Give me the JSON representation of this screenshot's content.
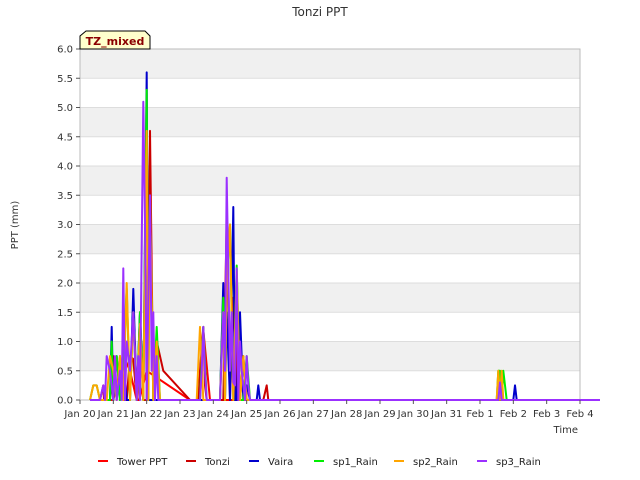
{
  "chart_data": {
    "type": "line",
    "title": "Tonzi PPT",
    "badge": "TZ_mixed",
    "xlabel": "Time",
    "ylabel": "PPT (mm)",
    "ylim": [
      0,
      6
    ],
    "yticks": [
      0.0,
      0.5,
      1.0,
      1.5,
      2.0,
      2.5,
      3.0,
      3.5,
      4.0,
      4.5,
      5.0,
      5.5,
      6.0
    ],
    "ytick_labels": [
      "0.0",
      "0.5",
      "1.0",
      "1.5",
      "2.0",
      "2.5",
      "3.0",
      "3.5",
      "4.0",
      "4.5",
      "5.0",
      "5.5",
      "6.0"
    ],
    "xlim": [
      0,
      15
    ],
    "xticks": [
      0,
      1,
      2,
      3,
      4,
      5,
      6,
      7,
      8,
      9,
      10,
      11,
      12,
      13,
      14,
      15
    ],
    "xtick_labels": [
      "Jan 20",
      "Jan 21",
      "Jan 22",
      "Jan 23",
      "Jan 24",
      "Jan 25",
      "Jan 26",
      "Jan 27",
      "Jan 28",
      "Jan 29",
      "Jan 30",
      "Jan 31",
      "Feb 1",
      "Feb 2",
      "Feb 3",
      "Feb 4"
    ],
    "grid": "horizontal bands",
    "legend_position": "bottom",
    "colors": {
      "band": "#f0f0f0",
      "grid": "#dddddd",
      "axis": "#bbbbbb",
      "badge_bg": "#ffffcc"
    },
    "series": [
      {
        "name": "Tower PPT",
        "color": "#ff0000",
        "x": [
          0.3,
          1.0,
          1.2,
          1.35,
          1.5,
          1.7,
          1.78,
          2.0,
          3.3,
          3.6,
          3.7,
          3.9,
          4.0,
          4.2,
          4.3,
          4.5,
          4.6,
          4.7,
          4.85,
          5.0,
          5.1,
          5.2,
          5.3,
          5.5,
          7.5,
          10.0,
          12.5,
          13.5,
          15.6
        ],
        "y": [
          0,
          0,
          0.5,
          0.7,
          0.5,
          0,
          0,
          0.5,
          0,
          0,
          1.2,
          0,
          0,
          0,
          0,
          0,
          0,
          0,
          0,
          0,
          0,
          0,
          0,
          0,
          0,
          0,
          0,
          0,
          0
        ]
      },
      {
        "name": "Tonzi",
        "color": "#cc0000",
        "x": [
          0.3,
          0.6,
          0.7,
          0.72,
          0.9,
          1.0,
          1.1,
          1.2,
          1.3,
          1.32,
          1.4,
          1.5,
          1.6,
          1.7,
          1.72,
          1.8,
          1.9,
          2.0,
          2.1,
          2.2,
          2.3,
          2.5,
          3.3,
          3.5,
          3.55,
          3.6,
          3.7,
          3.75,
          3.8,
          3.9,
          4.0,
          4.2,
          4.22,
          4.3,
          4.4,
          4.45,
          4.5,
          4.6,
          4.7,
          4.72,
          4.8,
          4.9,
          5.0,
          5.1,
          5.2,
          5.4,
          5.5,
          5.6,
          5.65,
          5.7,
          6.0,
          12.0,
          12.6,
          12.65,
          12.7,
          12.8,
          15.6
        ],
        "y": [
          0,
          0,
          0.25,
          0,
          0,
          0.75,
          0,
          0.75,
          0,
          0,
          0,
          0.75,
          0.7,
          0,
          0,
          1.5,
          0,
          0,
          4.6,
          0,
          1.0,
          0.5,
          0,
          0,
          0,
          0.5,
          1.25,
          0.25,
          0,
          0,
          0,
          0,
          0,
          0,
          3.1,
          2.0,
          0,
          1.75,
          0,
          1.0,
          0,
          0.75,
          0,
          0,
          0,
          0,
          0,
          0.25,
          0,
          0,
          0,
          0,
          0,
          0.25,
          0,
          0,
          0
        ]
      },
      {
        "name": "Vaira",
        "color": "#0000cc",
        "x": [
          0.3,
          0.7,
          0.9,
          0.95,
          1.0,
          1.1,
          1.2,
          1.3,
          1.4,
          1.5,
          1.6,
          1.7,
          1.8,
          1.9,
          2.0,
          2.05,
          2.1,
          2.15,
          2.2,
          2.3,
          2.5,
          3.3,
          3.7,
          3.8,
          4.0,
          4.2,
          4.3,
          4.35,
          4.4,
          4.5,
          4.6,
          4.65,
          4.7,
          4.8,
          4.9,
          5.0,
          5.1,
          5.3,
          5.35,
          5.4,
          6.0,
          12.0,
          12.6,
          12.7,
          12.8,
          13.0,
          13.05,
          13.1,
          15.6
        ],
        "y": [
          0,
          0,
          0,
          1.25,
          0,
          0.75,
          0,
          0.75,
          0,
          0,
          1.9,
          0,
          1.5,
          0,
          5.6,
          0,
          0,
          0,
          0,
          0,
          0,
          0,
          0,
          0,
          0,
          0,
          2.0,
          0,
          1.5,
          0,
          3.3,
          0,
          0,
          1.5,
          0,
          0.25,
          0,
          0,
          0.25,
          0,
          0,
          0,
          0,
          0,
          0,
          0,
          0.25,
          0,
          0
        ]
      },
      {
        "name": "sp1_Rain",
        "color": "#00ee00",
        "x": [
          0.3,
          0.4,
          0.5,
          0.6,
          0.9,
          0.95,
          1.0,
          1.1,
          1.2,
          1.3,
          1.4,
          1.5,
          1.6,
          1.7,
          1.8,
          1.9,
          2.0,
          2.05,
          2.1,
          2.2,
          2.3,
          2.4,
          2.5,
          3.3,
          3.6,
          3.7,
          3.8,
          4.0,
          4.2,
          4.3,
          4.35,
          4.4,
          4.5,
          4.6,
          4.7,
          4.8,
          4.9,
          5.0,
          5.1,
          5.3,
          6.0,
          12.0,
          12.5,
          12.55,
          12.6,
          12.65,
          12.7,
          12.8,
          15.6
        ],
        "y": [
          0,
          0.25,
          0.25,
          0,
          0,
          1.0,
          0,
          0.75,
          0,
          0.75,
          1.9,
          0,
          1.5,
          0,
          1.5,
          0,
          5.3,
          0,
          3.4,
          0,
          1.25,
          0,
          0,
          0,
          0,
          1.25,
          0,
          0,
          0,
          1.75,
          0,
          2.0,
          3.0,
          0,
          2.3,
          0,
          0,
          0.75,
          0,
          0,
          0,
          0,
          0,
          0.5,
          0.5,
          0,
          0.5,
          0,
          0
        ]
      },
      {
        "name": "sp2_Rain",
        "color": "#ffa500",
        "x": [
          0.3,
          0.4,
          0.5,
          0.6,
          0.8,
          0.9,
          1.0,
          1.1,
          1.2,
          1.3,
          1.4,
          1.5,
          1.6,
          1.7,
          1.8,
          1.9,
          2.0,
          2.05,
          2.1,
          2.2,
          2.3,
          2.4,
          3.3,
          3.5,
          3.6,
          3.7,
          3.8,
          4.0,
          4.2,
          4.3,
          4.35,
          4.4,
          4.5,
          4.6,
          4.7,
          4.8,
          4.9,
          5.0,
          5.1,
          5.3,
          6.0,
          12.0,
          12.5,
          12.55,
          12.6,
          12.65,
          12.7,
          12.8,
          15.6
        ],
        "y": [
          0,
          0.25,
          0.25,
          0,
          0,
          0.75,
          0.5,
          0,
          0.75,
          0,
          2.0,
          0,
          1.5,
          0,
          1.3,
          0,
          4.6,
          0,
          3.4,
          0,
          1.0,
          0,
          0,
          0,
          1.25,
          0,
          0,
          0,
          0,
          1.5,
          0,
          2.0,
          3.0,
          0,
          2.2,
          0,
          0.75,
          0,
          0,
          0,
          0,
          0,
          0,
          0.5,
          0,
          0.5,
          0,
          0,
          0
        ]
      },
      {
        "name": "sp3_Rain",
        "color": "#9b30ff",
        "x": [
          0.3,
          0.6,
          0.7,
          0.75,
          0.8,
          0.9,
          1.0,
          1.05,
          1.1,
          1.2,
          1.25,
          1.3,
          1.35,
          1.4,
          1.5,
          1.6,
          1.7,
          1.75,
          1.8,
          1.9,
          1.95,
          2.0,
          2.1,
          2.15,
          2.2,
          2.25,
          2.3,
          2.35,
          2.4,
          2.5,
          3.3,
          3.5,
          3.6,
          3.65,
          3.7,
          3.75,
          3.8,
          4.0,
          4.1,
          4.2,
          4.3,
          4.35,
          4.4,
          4.5,
          4.55,
          4.6,
          4.65,
          4.7,
          4.75,
          4.8,
          4.85,
          4.9,
          4.95,
          5.0,
          5.05,
          5.1,
          5.2,
          5.5,
          6.0,
          12.0,
          12.55,
          12.6,
          12.65,
          12.7,
          15.6
        ],
        "y": [
          0,
          0,
          0.25,
          0,
          0.75,
          0.5,
          0,
          0.75,
          0,
          0.5,
          0,
          2.25,
          0,
          1.0,
          0.5,
          1.5,
          0,
          0.75,
          0,
          5.1,
          3.0,
          0,
          3.5,
          0.5,
          1.5,
          0,
          0.75,
          0,
          0,
          0,
          0,
          0,
          0,
          0.5,
          1.25,
          0.5,
          0,
          0,
          0,
          0,
          1.5,
          0.5,
          3.8,
          0.5,
          1.5,
          0.3,
          0.25,
          2.25,
          0,
          1.0,
          0.5,
          0.25,
          0,
          0.75,
          0.25,
          0,
          0,
          0,
          0,
          0,
          0,
          0.3,
          0,
          0,
          0
        ]
      }
    ]
  }
}
